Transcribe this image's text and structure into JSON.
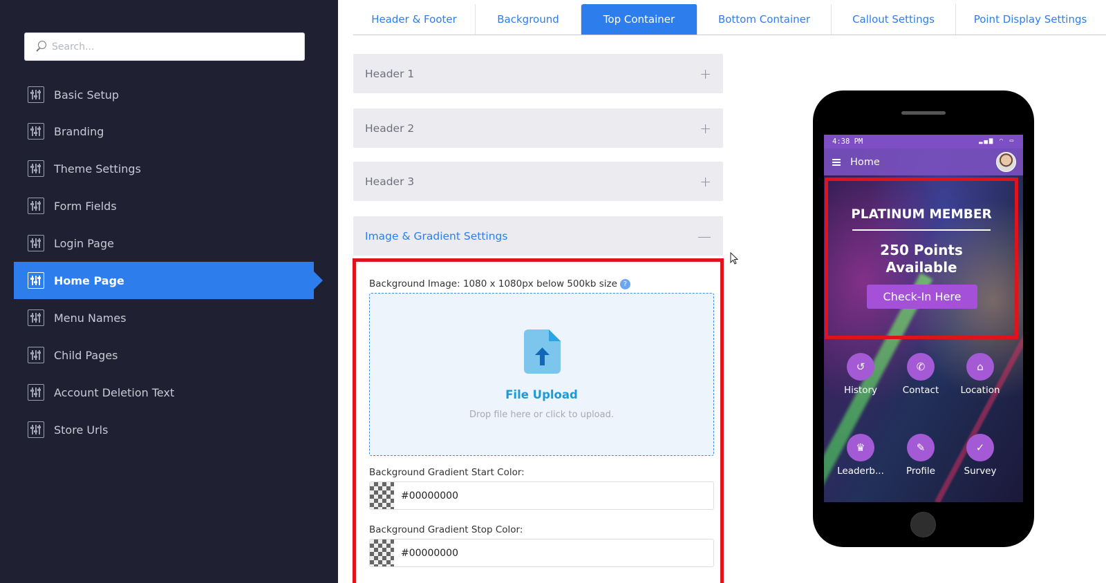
{
  "sidebar": {
    "search_placeholder": "Search...",
    "items": [
      {
        "label": "Basic Setup"
      },
      {
        "label": "Branding"
      },
      {
        "label": "Theme Settings"
      },
      {
        "label": "Form Fields"
      },
      {
        "label": "Login Page"
      },
      {
        "label": "Home Page",
        "active": true
      },
      {
        "label": "Menu Names"
      },
      {
        "label": "Child Pages"
      },
      {
        "label": "Account Deletion Text"
      },
      {
        "label": "Store Urls"
      }
    ]
  },
  "tabs": [
    {
      "label": "Header & Footer"
    },
    {
      "label": "Background"
    },
    {
      "label": "Top Container",
      "active": true
    },
    {
      "label": "Bottom Container"
    },
    {
      "label": "Callout Settings"
    },
    {
      "label": "Point Display Settings"
    }
  ],
  "accordion": [
    {
      "label": "Header 1",
      "toggle": "+"
    },
    {
      "label": "Header 2",
      "toggle": "+"
    },
    {
      "label": "Header 3",
      "toggle": "+"
    },
    {
      "label": "Image & Gradient Settings",
      "toggle": "—",
      "open": true
    }
  ],
  "image_settings": {
    "bg_image_label": "Background Image: 1080 x 1080px below 500kb size",
    "help": "?",
    "upload_title": "File Upload",
    "upload_hint": "Drop file here or click to upload.",
    "gradient_start_label": "Background Gradient Start Color:",
    "gradient_start_value": "#00000000",
    "gradient_stop_label": "Background Gradient Stop Color:",
    "gradient_stop_value": "#00000000"
  },
  "preview": {
    "time": "4:38 PM",
    "app_title": "Home",
    "member_title": "PLATINUM MEMBER",
    "points_line1": "250 Points",
    "points_line2": "Available",
    "checkin_label": "Check-In Here",
    "tiles": [
      {
        "label": "History",
        "icon": "history-icon"
      },
      {
        "label": "Contact",
        "icon": "phone-icon"
      },
      {
        "label": "Location",
        "icon": "home-icon"
      },
      {
        "label": "Leaderb...",
        "icon": "trophy-icon"
      },
      {
        "label": "Profile",
        "icon": "profile-edit-icon"
      },
      {
        "label": "Survey",
        "icon": "check-icon"
      }
    ]
  },
  "colors": {
    "sidebar_bg": "#1f2032",
    "accent": "#2e7ded",
    "highlight_red": "#e0131c",
    "tile_purple": "#a45ad4"
  }
}
